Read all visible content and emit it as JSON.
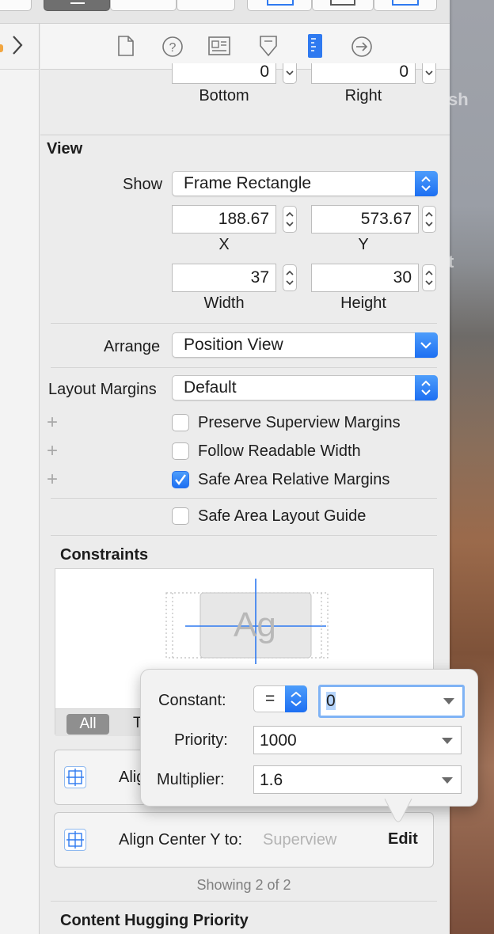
{
  "inspector": {
    "bottom_value": "0",
    "right_value": "0",
    "bottom_label": "Bottom",
    "right_label": "Right"
  },
  "view_section": {
    "title": "View",
    "show_label": "Show",
    "show_value": "Frame Rectangle",
    "x_value": "188.67",
    "y_value": "573.67",
    "x_label": "X",
    "y_label": "Y",
    "width_value": "37",
    "height_value": "30",
    "width_label": "Width",
    "height_label": "Height",
    "arrange_label": "Arrange",
    "arrange_value": "Position View",
    "layout_margins_label": "Layout Margins",
    "layout_margins_value": "Default",
    "checkboxes": [
      {
        "label": "Preserve Superview Margins",
        "checked": false
      },
      {
        "label": "Follow Readable Width",
        "checked": false
      },
      {
        "label": "Safe Area Relative Margins",
        "checked": true
      },
      {
        "label": "Safe Area Layout Guide",
        "checked": false
      }
    ]
  },
  "constraints": {
    "title": "Constraints",
    "preview_text": "Ag",
    "filter_all": "All",
    "filter_partial": "T",
    "row1_label": "Alig",
    "row2_label": "Align Center Y to:",
    "row2_target": "Superview",
    "row2_action": "Edit",
    "footer": "Showing 2 of 2"
  },
  "popover": {
    "constant_label": "Constant:",
    "relation": "=",
    "constant_value": "0",
    "priority_label": "Priority:",
    "priority_value": "1000",
    "multiplier_label": "Multiplier:",
    "multiplier_value": "1.6"
  },
  "content_hugging": {
    "title": "Content Hugging Priority"
  },
  "wallpaper_text": {
    "a": "sh",
    "b": "t"
  },
  "colors": {
    "accent": "#1d6ff2",
    "panel": "#ececec"
  }
}
